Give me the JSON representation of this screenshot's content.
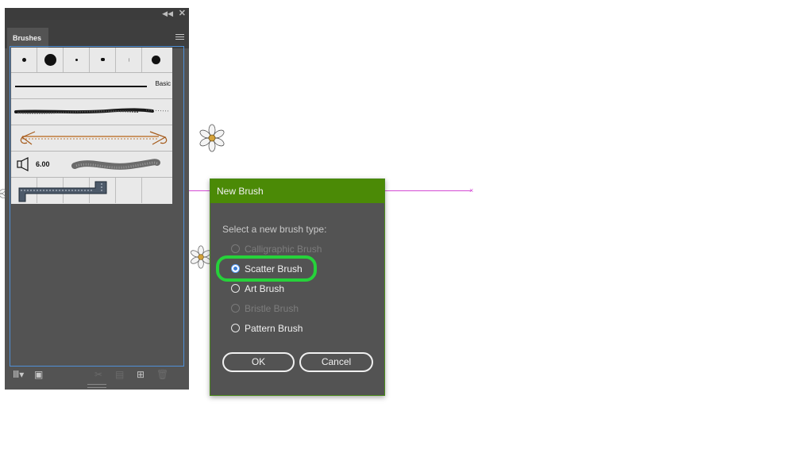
{
  "panel": {
    "title": "Brushes",
    "collapse_icon": "double-chevron-left-icon",
    "close_icon": "close-icon",
    "menu_icon": "hamburger-menu-icon",
    "basic_label": "Basic",
    "brush_value": "6.00",
    "footer_icons": [
      "brush-libraries-icon",
      "library-panel-icon",
      "remove-stroke-icon",
      "brush-options-icon",
      "new-brush-icon",
      "delete-brush-icon"
    ]
  },
  "dialog": {
    "title": "New Brush",
    "prompt": "Select a new brush type:",
    "options": [
      {
        "label": "Calligraphic Brush",
        "enabled": false,
        "selected": false
      },
      {
        "label": "Scatter Brush",
        "enabled": true,
        "selected": true
      },
      {
        "label": "Art Brush",
        "enabled": true,
        "selected": false
      },
      {
        "label": "Bristle Brush",
        "enabled": false,
        "selected": false
      },
      {
        "label": "Pattern Brush",
        "enabled": true,
        "selected": false
      }
    ],
    "ok_label": "OK",
    "cancel_label": "Cancel",
    "title_bar_color": "#4b8a06",
    "highlight_color": "#26d23a"
  },
  "canvas": {
    "path_color": "#d44ad4"
  }
}
